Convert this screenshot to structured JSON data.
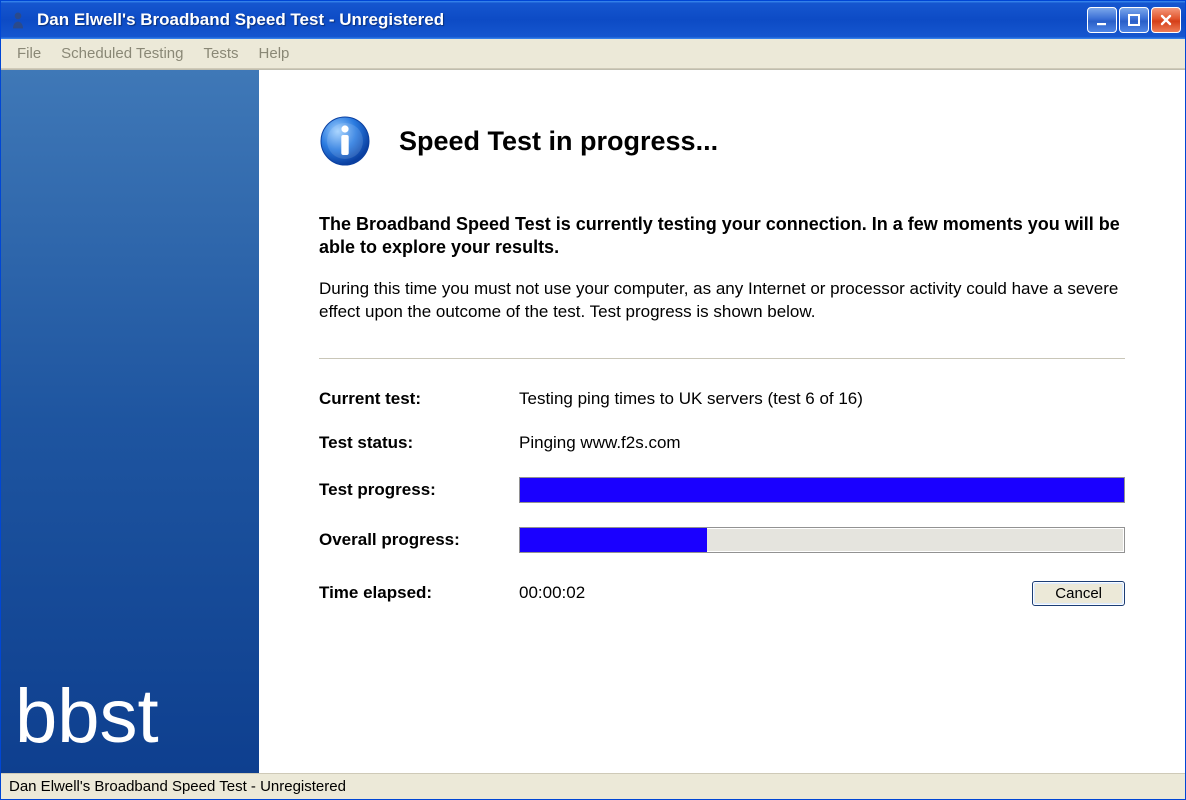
{
  "window": {
    "title": "Dan Elwell's Broadband Speed Test - Unregistered"
  },
  "menubar": {
    "items": [
      "File",
      "Scheduled Testing",
      "Tests",
      "Help"
    ]
  },
  "sidebar": {
    "brand": "bbst"
  },
  "main": {
    "heading": "Speed Test in progress...",
    "intro_bold": "The Broadband Speed Test is currently testing your connection. In a few moments you will be able to explore your results.",
    "intro_plain": "During this time you must not use your computer, as any Internet or processor activity could have a severe effect upon the outcome of the test. Test progress is shown below.",
    "rows": {
      "current_test_label": "Current test:",
      "current_test_value": "Testing ping times to UK servers (test 6 of 16)",
      "test_status_label": "Test status:",
      "test_status_value": "Pinging www.f2s.com",
      "test_progress_label": "Test progress:",
      "test_progress_percent": 100,
      "overall_progress_label": "Overall progress:",
      "overall_progress_percent": 31,
      "time_elapsed_label": "Time elapsed:",
      "time_elapsed_value": "00:00:02"
    },
    "cancel_label": "Cancel"
  },
  "statusbar": {
    "text": "Dan Elwell's Broadband Speed Test - Unregistered"
  },
  "colors": {
    "titlebar_blue": "#0d4bc5",
    "sidebar_blue_top": "#3f78b7",
    "sidebar_blue_bottom": "#0e3f8f",
    "progress_fill": "#1a00ff",
    "xp_face": "#ece9d8"
  }
}
